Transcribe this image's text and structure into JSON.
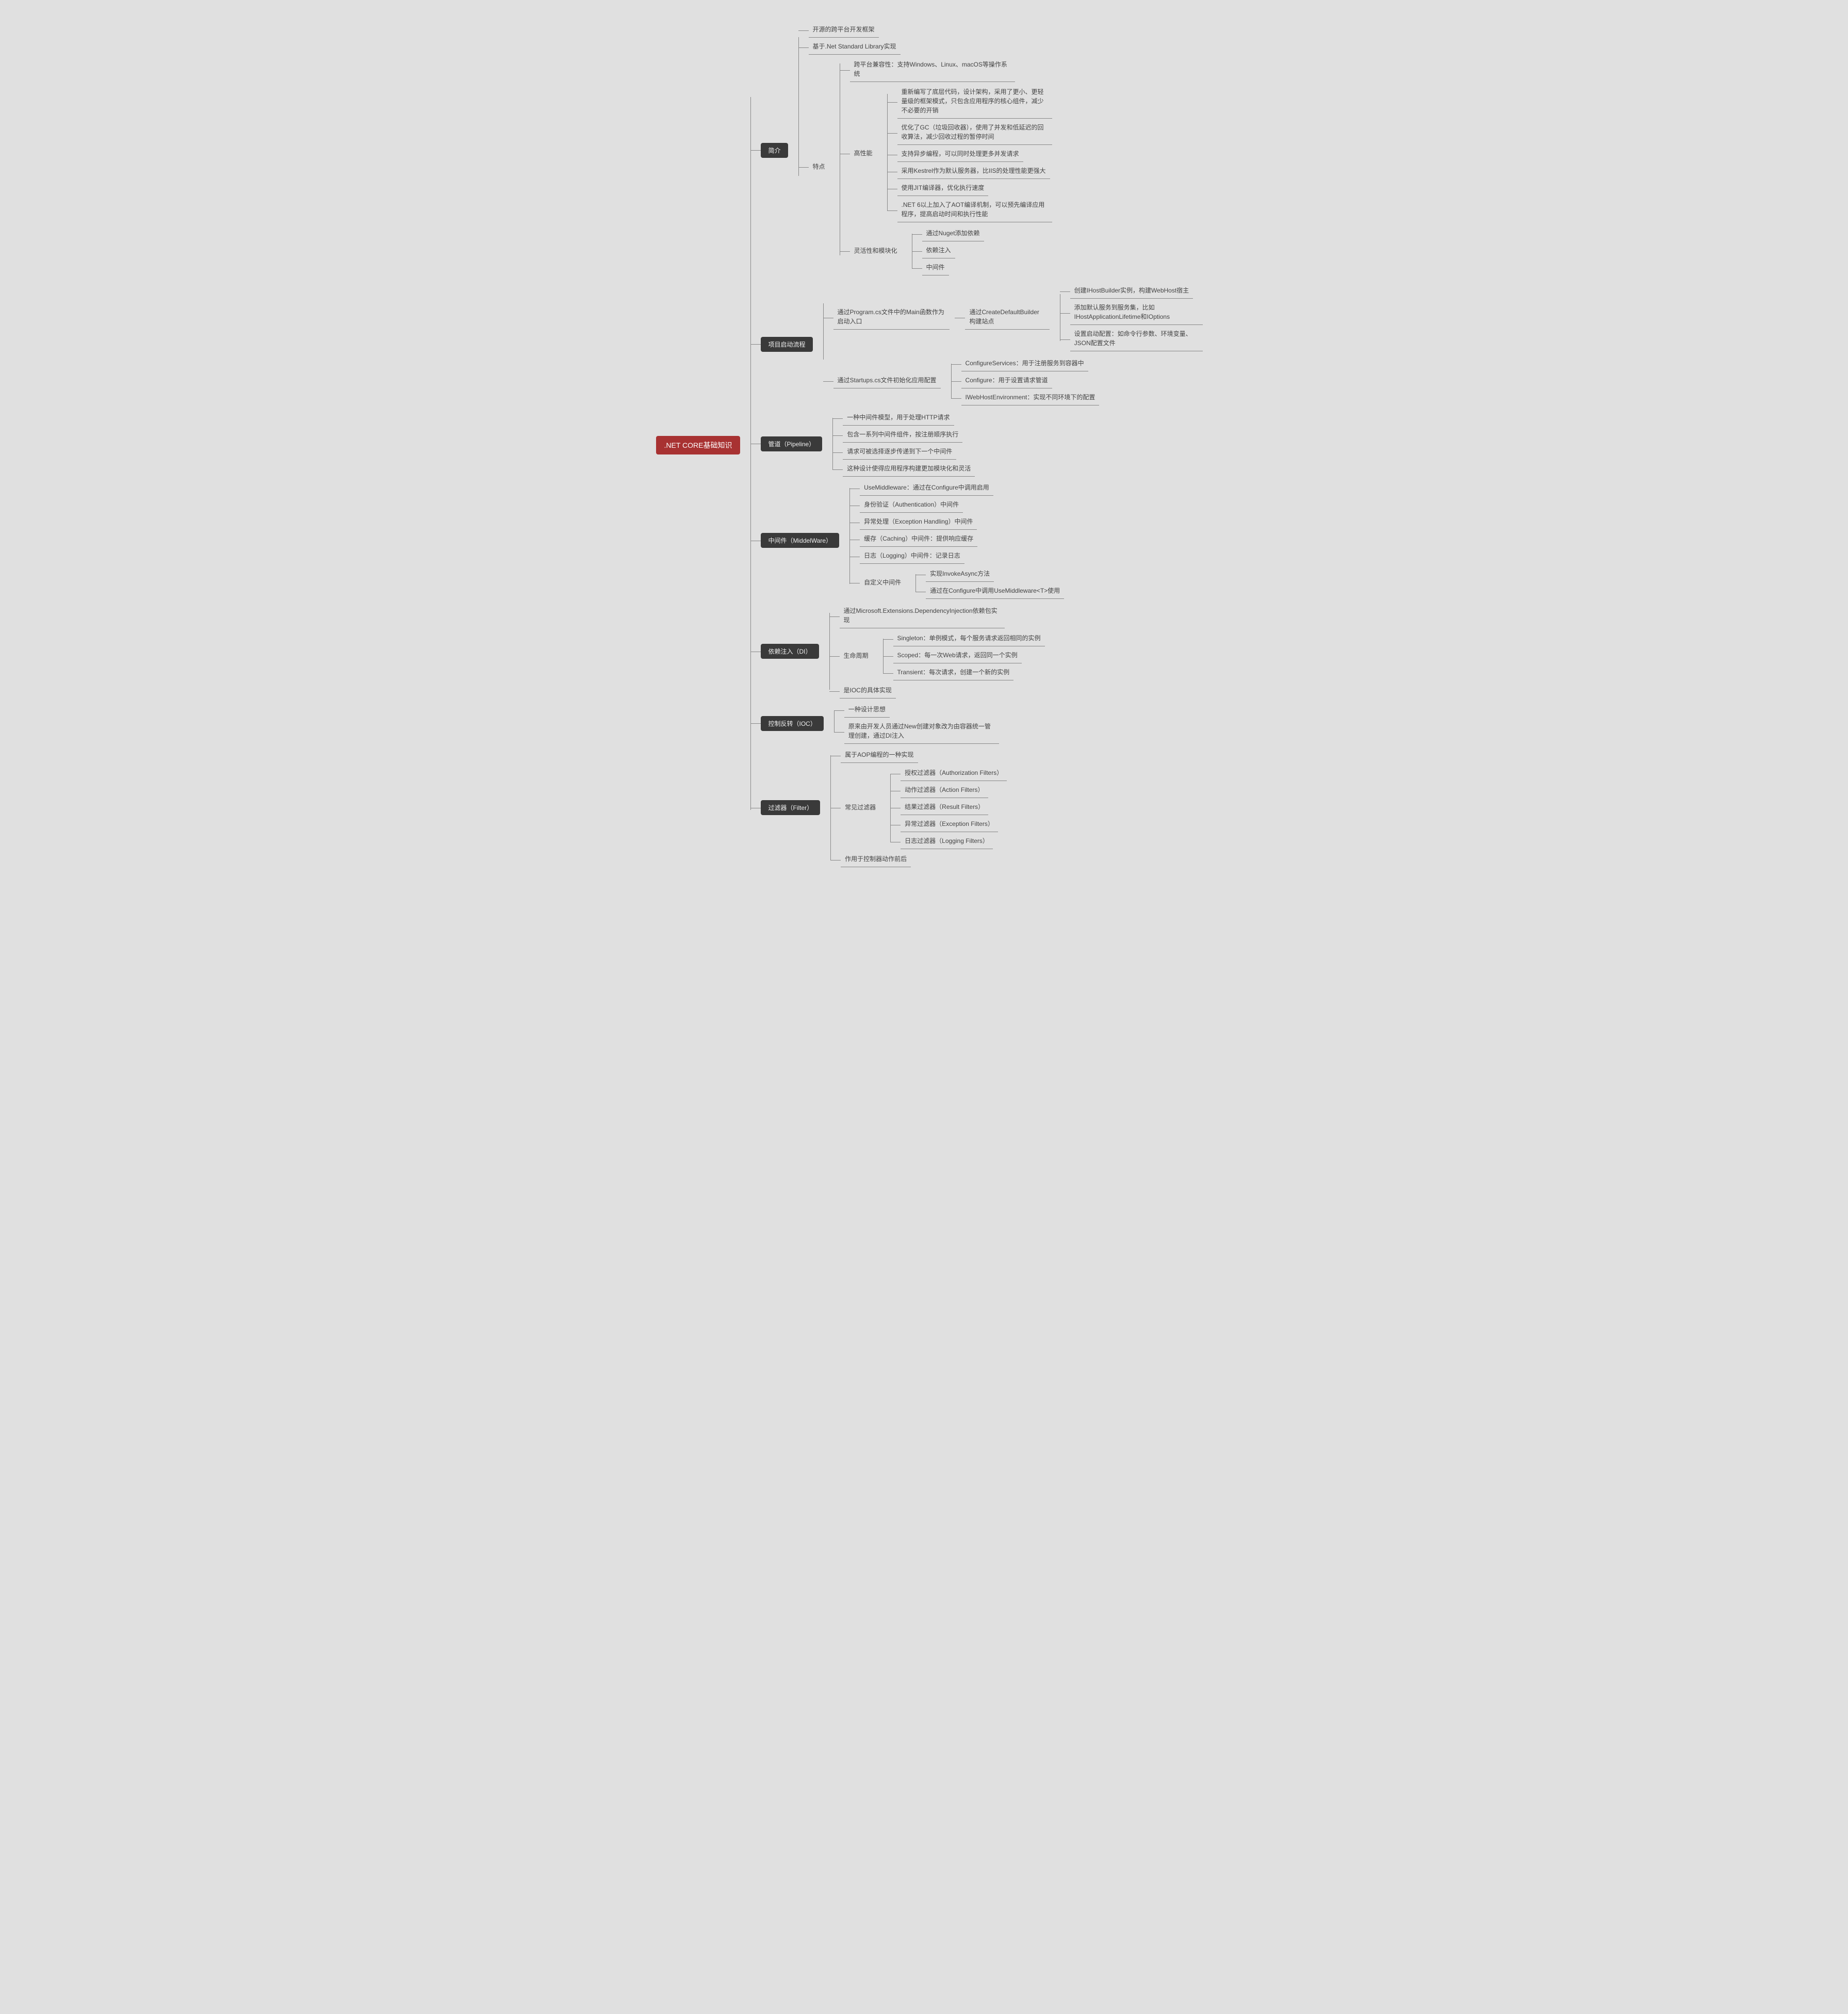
{
  "root": ".NET CORE基础知识",
  "intro": {
    "title": "简介",
    "i1": "开源的跨平台开发框架",
    "i2": "基于.Net Standard Library实现",
    "features_title": "特点",
    "cross": "跨平台兼容性：支持Windows、Linux、macOS等操作系统",
    "perf_title": "高性能",
    "p1": "重新编写了底层代码，设计架构，采用了更小、更轻量级的框架模式，只包含应用程序的核心组件，减少不必要的开销",
    "p2": "优化了GC（垃圾回收器），使用了并发和低延迟的回收算法，减少回收过程的暂停时间",
    "p3": "支持异步编程，可以同时处理更多并发请求",
    "p4": "采用Kestrel作为默认服务器，比IIS的处理性能更强大",
    "p5": "使用JIT编译器，优化执行速度",
    "p6": ".NET 6以上加入了AOT编译机制，可以预先编译应用程序，提高启动时间和执行性能",
    "flex_title": "灵活性和模块化",
    "f1": "通过Nuget添加依赖",
    "f2": "依赖注入",
    "f3": "中间件"
  },
  "startup": {
    "title": "项目启动流程",
    "s1": "通过Program.cs文件中的Main函数作为启动入口",
    "s1b": "通过CreateDefaultBuilder构建站点",
    "s1c1": "创建IHostBuilder实例，构建WebHost宿主",
    "s1c2": "添加默认服务到服务集，比如IHostApplicationLifetime和IOptions",
    "s1c3": "设置启动配置：如命令行参数、环境变量、JSON配置文件",
    "s2": "通过Startups.cs文件初始化应用配置",
    "s2a": "ConfigureServices：用于注册服务到容器中",
    "s2b": "Configure：用于设置请求管道",
    "s2c": "IWebHostEnvironment：实现不同环境下的配置"
  },
  "pipeline": {
    "title": "管道（Pipeline）",
    "p1": "一种中间件模型，用于处理HTTP请求",
    "p2": "包含一系列中间件组件，按注册顺序执行",
    "p3": "请求可被选择逐步传递到下一个中间件",
    "p4": "这种设计使得应用程序构建更加模块化和灵活"
  },
  "middleware": {
    "title": "中间件（MiddelWare）",
    "m1": "UseMiddleware：通过在Configure中调用启用",
    "m2": "身份验证（Authentication）中间件",
    "m3": "异常处理（Exception Handling）中间件",
    "m4": "缓存（Caching）中间件：提供响应缓存",
    "m5": "日志（Logging）中间件：记录日志",
    "custom_title": "自定义中间件",
    "c1": "实现InvokeAsync方法",
    "c2": "通过在Configure中调用UseMiddleware<T>使用"
  },
  "di": {
    "title": "依赖注入（DI）",
    "d1": "通过Microsoft.Extensions.DependencyInjection依赖包实现",
    "life_title": "生命周期",
    "l1": "Singleton：单例模式，每个服务请求返回相同的实例",
    "l2": "Scoped：每一次Web请求，返回同一个实例",
    "l3": "Transient：每次请求，创建一个新的实例",
    "d2": "是IOC的具体实现"
  },
  "ioc": {
    "title": "控制反转（IOC）",
    "i1": "一种设计思想",
    "i2": "原来由开发人员通过New创建对象改为由容器统一管理创建，通过DI注入"
  },
  "filter": {
    "title": "过滤器（Filter）",
    "f0": "属于AOP编程的一种实现",
    "common_title": "常见过滤器",
    "c1": "授权过滤器（Authorization Filters）",
    "c2": "动作过滤器（Action Filters）",
    "c3": "结果过滤器（Result Filters）",
    "c4": "异常过滤器（Exception Filters）",
    "c5": "日志过滤器（Logging Filters）",
    "f1": "作用于控制器动作前后"
  }
}
